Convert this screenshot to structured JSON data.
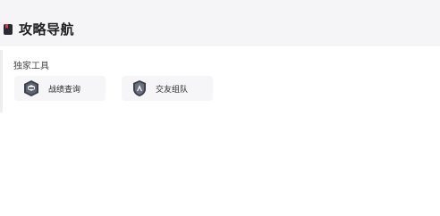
{
  "header": {
    "title": "攻略导航",
    "icon": "book-icon"
  },
  "section": {
    "title": "独家工具",
    "tools": [
      {
        "label": "战绩查询",
        "icon": "crest-badge-icon"
      },
      {
        "label": "交友组队",
        "icon": "team-badge-icon"
      }
    ]
  },
  "colors": {
    "title_icon": "#2a2a35",
    "title_icon_accent": "#e23a4a",
    "card_bg": "#f6f6f8",
    "header_bg": "#f5f5f7"
  }
}
